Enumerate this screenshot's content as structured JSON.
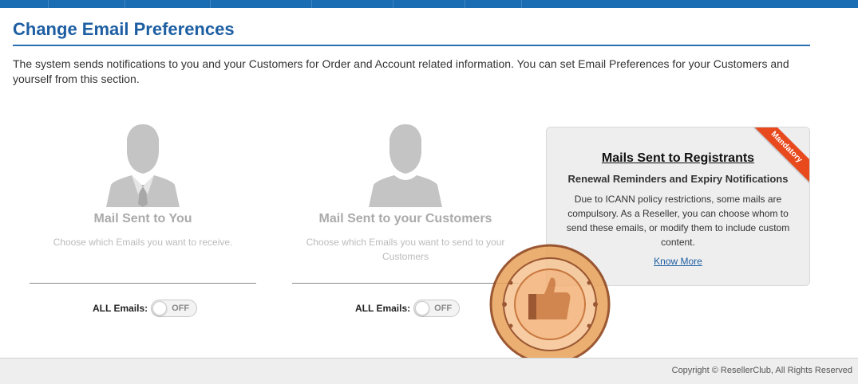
{
  "header": {
    "title": "Change Email Preferences",
    "intro": "The system sends notifications to you and your Customers for Order and Account related information. You can set Email Preferences for your Customers and yourself from this section."
  },
  "panels": [
    {
      "title": "Mail Sent to You",
      "description": "Choose which Emails you want to receive.",
      "toggle_label": "ALL Emails:",
      "toggle_state": "OFF"
    },
    {
      "title": "Mail Sent to your Customers",
      "description": "Choose which Emails you want to send to your Customers",
      "toggle_label": "ALL Emails:",
      "toggle_state": "OFF"
    }
  ],
  "registrants_card": {
    "ribbon": "Mandatory",
    "title": "Mails Sent to Registrants",
    "subtitle": "Renewal Reminders and Expiry Notifications",
    "body": "Due to ICANN policy restrictions, some mails are compulsory. As a Reseller, you can choose whom to send these emails, or modify them to include custom content.",
    "link": "Know More"
  },
  "footer": {
    "copyright": "Copyright © ResellerClub, All Rights Reserved"
  },
  "colors": {
    "brand_blue": "#1e5fa3",
    "ribbon_orange": "#e8491d"
  },
  "icons": {
    "avatar_you": "user-tie-icon",
    "avatar_customers": "user-icon"
  }
}
